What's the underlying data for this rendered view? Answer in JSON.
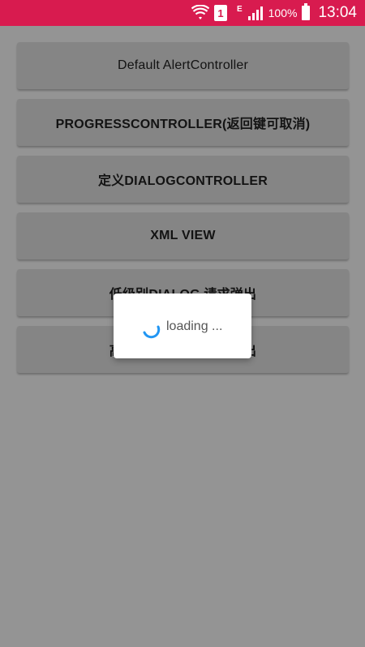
{
  "status_bar": {
    "sim_label": "1",
    "network_type": "E",
    "battery_percent": "100%",
    "time": "13:04",
    "icons": [
      "wifi-icon",
      "sim-icon",
      "signal-icon",
      "battery-icon"
    ],
    "background": "#d81b4f"
  },
  "buttons": [
    {
      "label": "Default AlertController"
    },
    {
      "label": "PROGRESSCONTROLLER(返回键可取消)"
    },
    {
      "label": "定义DIALOGCONTROLLER"
    },
    {
      "label": "XML VIEW"
    },
    {
      "label": "低级别DIALOG,请求弹出"
    },
    {
      "label": "高级别DIALOG,请求弹出"
    }
  ],
  "dialog": {
    "text": "loading ...",
    "icon": "spinner-icon",
    "spinner_color": "#2196f3"
  }
}
